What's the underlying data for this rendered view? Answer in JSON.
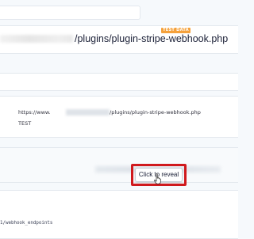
{
  "header": {
    "badge": "TEST DATA",
    "url_path": "/plugins/plugin-stripe-webhook.php"
  },
  "detail": {
    "url_prefix": "https://www.",
    "url_path": "/plugins/plugin-stripe-webhook.php",
    "mode": "TEST"
  },
  "secret": {
    "reveal_label": "Click to reveal"
  },
  "endpoint": {
    "path": "1/webhook_endpoints"
  },
  "colors": {
    "badge": "#f5a13b",
    "highlight": "#d0191d",
    "text": "#1a1f36"
  }
}
